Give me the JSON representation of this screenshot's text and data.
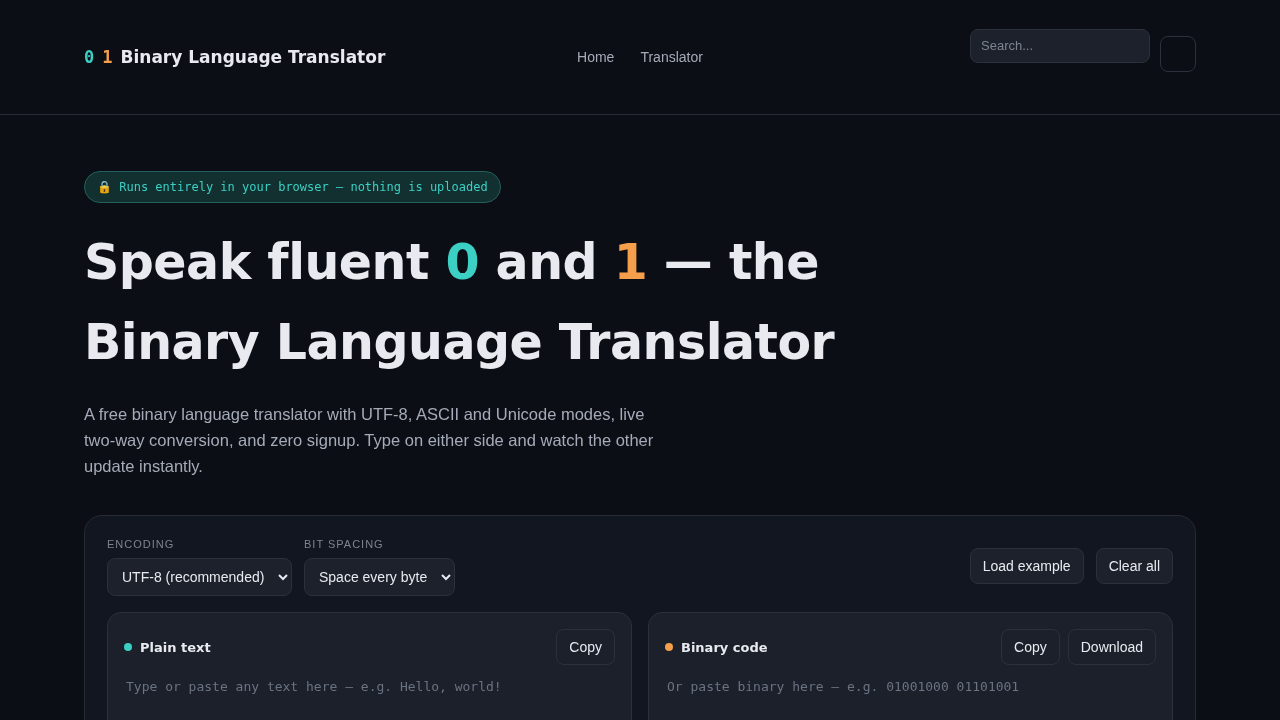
{
  "header": {
    "logo_digits": [
      "0",
      "1"
    ],
    "title": "Binary Language Translator",
    "nav": [
      {
        "label": "Home"
      },
      {
        "label": "Translator"
      }
    ],
    "search": {
      "placeholder": "Search..."
    }
  },
  "badge": "🔒 Runs entirely in your browser — nothing is uploaded",
  "heading": [
    {
      "text": "Speak fluent ",
      "kind": "plain"
    },
    {
      "text": "0",
      "kind": "zero"
    },
    {
      "text": " and ",
      "kind": "plain"
    },
    {
      "text": "1",
      "kind": "one"
    },
    {
      "text": " — the Binary Language Translator",
      "kind": "plain"
    }
  ],
  "intro": "A free binary language translator with UTF‑8, ASCII and Unicode modes, live two‑way conversion, and zero signup. Type on either side and watch the other update instantly.",
  "controls": {
    "selects": [
      {
        "label": "ENCODING",
        "value": "UTF‑8 (recommended)"
      },
      {
        "label": "BIT SPACING",
        "value": "Space every byte"
      }
    ],
    "buttons": [
      "Load example",
      "Clear all"
    ]
  },
  "panels": [
    {
      "title": "Plain text",
      "color": "#3ccfc4",
      "buttons": [
        "Copy"
      ],
      "placeholder": "Type or paste any text here — e.g. Hello, world!"
    },
    {
      "title": "Binary code",
      "color": "#f59e4b",
      "buttons": [
        "Copy",
        "Download"
      ],
      "placeholder": "Or paste binary here — e.g. 01001000 01101001"
    }
  ]
}
